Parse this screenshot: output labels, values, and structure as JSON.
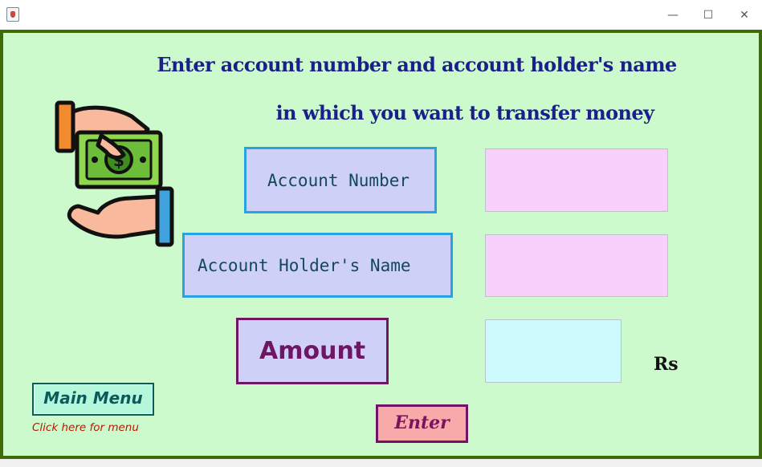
{
  "window": {
    "icon": "java-app-icon",
    "controls": {
      "minimize": "—",
      "maximize": "☐",
      "close": "✕"
    }
  },
  "heading": {
    "line1": "Enter account number and account holder's name",
    "line2": "in which you want to transfer money"
  },
  "form": {
    "account_number_label": "Account Number",
    "account_holder_label": "Account Holder's Name",
    "amount_label": "Amount",
    "account_number_value": "",
    "account_holder_value": "",
    "amount_value": "",
    "currency": "Rs"
  },
  "buttons": {
    "main_menu": "Main Menu",
    "main_menu_hint": "Click here for menu",
    "enter": "Enter"
  },
  "colors": {
    "background": "#cdfacd",
    "frame_border": "#3f6b06",
    "heading_text": "#1b1f8c",
    "label_bg": "#cfd0f7",
    "label_border": "#2aa1e3",
    "amount_border": "#6e1563",
    "text_field_bg": "#f9d0fb",
    "amount_field_bg": "#cdfafd",
    "menu_button_bg": "#b5f7da",
    "enter_button_bg": "#f8a9a9"
  },
  "icons": [
    "money-transfer-icon"
  ]
}
